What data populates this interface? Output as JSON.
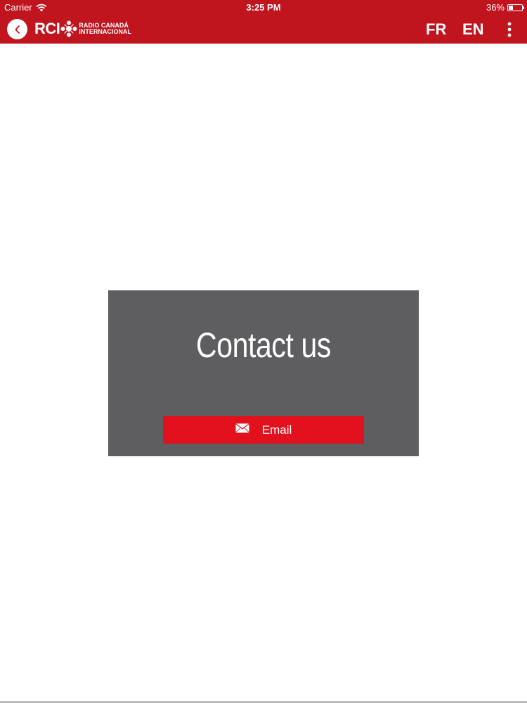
{
  "status_bar": {
    "carrier": "Carrier",
    "time": "3:25 PM",
    "battery_percent": "36%",
    "battery_level": 0.36
  },
  "nav": {
    "logo_main": "RCI",
    "logo_line1": "RADIO CANADÁ",
    "logo_line2": "INTERNACIONAL",
    "lang_fr": "FR",
    "lang_en": "EN",
    "icons": {
      "back": "back-icon",
      "more": "more-vertical-icon",
      "wifi": "wifi-icon",
      "battery": "battery-icon"
    }
  },
  "contact": {
    "title": "Contact us",
    "email_label": "Email",
    "email_icon": "envelope-icon"
  },
  "colors": {
    "brand_red": "#c0141e",
    "button_red": "#e2111d",
    "card_gray": "#5e5d60"
  }
}
